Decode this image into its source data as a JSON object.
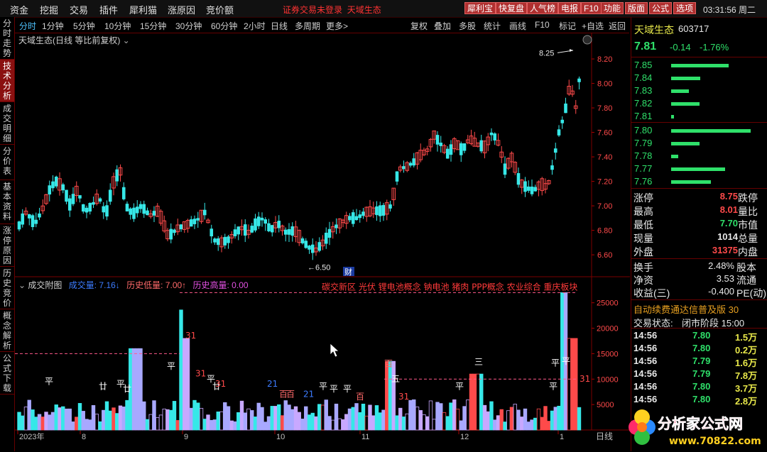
{
  "menu": [
    "资金",
    "挖掘",
    "交易",
    "插件",
    "犀利猫",
    "涨原因",
    "竞价额"
  ],
  "notice": "证券交易未登录",
  "notice_name": "天域生态",
  "top_buttons": [
    "犀利宝",
    "快复盘",
    "人气榜",
    "电报",
    "F10",
    "功能",
    "版面",
    "公式",
    "选项"
  ],
  "clock": "03:31:56 周二",
  "left_tabs": [
    "分时走势",
    "技术分析",
    "成交明细",
    "分价表",
    "基本资料",
    "涨停原因",
    "历史竞价",
    "概念解析",
    "公式下载"
  ],
  "active_left_tab": 1,
  "periods": [
    "分时",
    "1分钟",
    "5分钟",
    "10分钟",
    "15分钟",
    "30分钟",
    "60分钟",
    "2小时",
    "日线",
    "多周期",
    "更多>"
  ],
  "active_period": 0,
  "tools": [
    "复权",
    "叠加",
    "多股",
    "统计",
    "画线",
    "F10",
    "标记",
    "+自选",
    "返回"
  ],
  "chart_title": "天域生态(日线 等比前复权)",
  "high_marker": "8.25",
  "low_marker": "6.50",
  "cai_badge": "财",
  "volume_header": {
    "name": "成交附图",
    "vol_label": "成交量: 7.16",
    "low_label": "历史低量: 7.00",
    "high_label": "历史高量: 0.00"
  },
  "concept_tags": "碳交新区 光伏 锂电池概念 钠电池 猪肉 PPP概念  农业综合  重庆板块",
  "price_axis": [
    "8.20",
    "8.00",
    "7.80",
    "7.60",
    "7.40",
    "7.20",
    "7.00",
    "6.80",
    "6.60"
  ],
  "volume_axis": [
    "25000",
    "20000",
    "15000",
    "10000",
    "5000"
  ],
  "date_axis": [
    "2023年",
    "8",
    "9",
    "10",
    "11",
    "12",
    "1"
  ],
  "period_label": "日线",
  "vol_marks": [
    "平",
    "廿",
    "平",
    "廿",
    "平",
    "31",
    "31",
    "平",
    "廿",
    "31",
    "21",
    "百",
    "百",
    "21",
    "平",
    "平",
    "平",
    "百",
    "百",
    "五",
    "31",
    "平",
    "三",
    "平",
    "平",
    "平",
    "31"
  ],
  "stock": {
    "name": "天域生态",
    "code": "603717",
    "price": "7.81",
    "change": "-0.14",
    "pct": "-1.76%"
  },
  "asks": [
    {
      "p": "7.85",
      "w": 0.92
    },
    {
      "p": "7.84",
      "w": 0.47
    },
    {
      "p": "7.83",
      "w": 0.28
    },
    {
      "p": "7.82",
      "w": 0.45
    },
    {
      "p": "7.81",
      "w": 0.05
    }
  ],
  "bids": [
    {
      "p": "7.80",
      "w": 1.0
    },
    {
      "p": "7.79",
      "w": 0.36
    },
    {
      "p": "7.78",
      "w": 0.09
    },
    {
      "p": "7.77",
      "w": 0.68
    },
    {
      "p": "7.76",
      "w": 0.5
    }
  ],
  "stats": [
    {
      "l1": "涨停",
      "v1": "8.75",
      "c1": "red",
      "l2": "跌停"
    },
    {
      "l1": "最高",
      "v1": "8.01",
      "c1": "red",
      "l2": "量比"
    },
    {
      "l1": "最低",
      "v1": "7.70",
      "c1": "grn",
      "l2": "市值"
    },
    {
      "l1": "现量",
      "v1": "1014",
      "c1": "wht",
      "l2": "总量"
    },
    {
      "l1": "外盘",
      "v1": "31375",
      "c1": "red",
      "l2": "内盘"
    }
  ],
  "stats2": [
    {
      "l1": "换手",
      "v1": "2.48%",
      "l2": "股本"
    },
    {
      "l1": "净资",
      "v1": "3.53",
      "l2": "流通"
    },
    {
      "l1": "收益(三)",
      "v1": "-0.400",
      "l2": "PE(动)"
    }
  ],
  "ticker_text": "自动续费通达信普及版 30",
  "trade_state_label": "交易状态:",
  "trade_state_value": "闭市阶段 15:00",
  "ticks": [
    {
      "t": "14:56",
      "p": "7.80",
      "v": "1.5万"
    },
    {
      "t": "14:56",
      "p": "7.80",
      "v": "0.2万"
    },
    {
      "t": "14:56",
      "p": "7.79",
      "v": "1.6万"
    },
    {
      "t": "14:56",
      "p": "7.79",
      "v": "7.8万"
    },
    {
      "t": "14:56",
      "p": "7.80",
      "v": "3.7万"
    },
    {
      "t": "14:56",
      "p": "7.80",
      "v": "2.8万"
    }
  ],
  "watermark": {
    "brand": "分析家公式网",
    "url": "www.70822.com"
  },
  "colors": {
    "up": "#ff4a4a",
    "down": "#36e8e8",
    "bg": "#000000",
    "grid": "#6a0000",
    "accent": "#4fc3ff"
  }
}
